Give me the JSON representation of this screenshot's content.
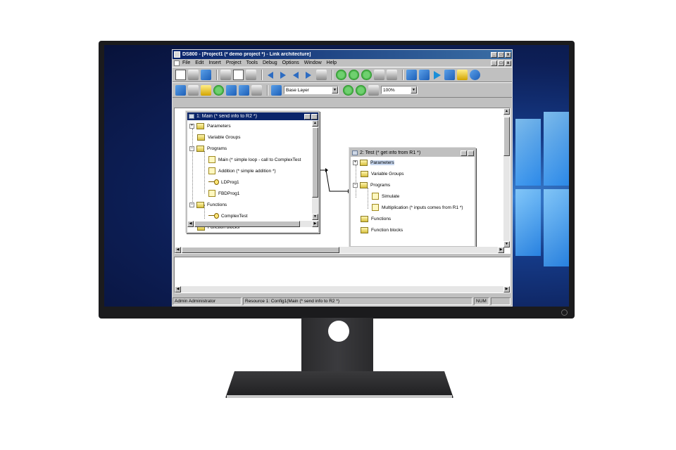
{
  "window": {
    "title": "DS800 - [Project1 (* demo project *) - Link architecture]",
    "controls": [
      "_",
      "□",
      "x"
    ]
  },
  "menu": [
    "File",
    "Edit",
    "Insert",
    "Project",
    "Tools",
    "Debug",
    "Options",
    "Window",
    "Help"
  ],
  "toolbar2": {
    "layer_combo": "Base Layer",
    "zoom_combo": "100%"
  },
  "children": {
    "main": {
      "title": "1: Main (* send info to R2 *)",
      "nodes": [
        "Parameters",
        "Variable Groups",
        "Programs",
        "Main (* simple loop - call to ComplexTest",
        "Addition (* simple addition *)",
        "LDProg1",
        "FBDProg1",
        "Functions",
        "ComplexTest",
        "Function blocks"
      ]
    },
    "test": {
      "title": "2: Test (* get info from R1 *)",
      "nodes": [
        "Parameters",
        "Variable Groups",
        "Programs",
        "Simulate",
        "Multiplication (* inputs comes from R1 *)",
        "Functions",
        "Function blocks"
      ]
    }
  },
  "status": {
    "user": "Admin Administrator",
    "resource": "Resource 1: Config1(Main (* send info to R2 *)",
    "num": "NUM"
  },
  "colors": {
    "title_active": "#0a246a",
    "chrome": "#c0c0c0",
    "desktop": "#153a87"
  },
  "icons": [
    "new-document-icon",
    "open-icon",
    "save-icon",
    "cut-icon",
    "copy-icon",
    "paste-icon",
    "back-arrow-icon",
    "forward-arrow-icon",
    "print-icon",
    "refresh-icon",
    "play-icon",
    "globe-icon"
  ]
}
